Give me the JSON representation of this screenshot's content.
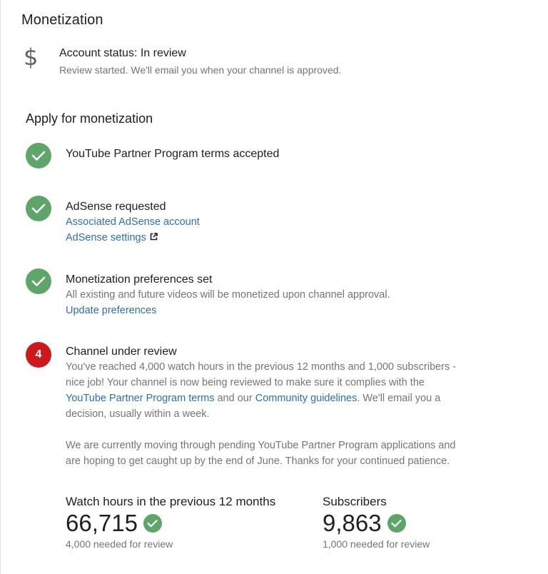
{
  "page": {
    "title": "Monetization"
  },
  "account_status": {
    "icon": "dollar-icon",
    "icon_glyph": "$",
    "title": "Account status: In review",
    "subtitle": "Review started. We'll email you when your channel is approved."
  },
  "apply": {
    "title": "Apply for monetization",
    "steps": [
      {
        "state": "done",
        "title": "YouTube Partner Program terms accepted"
      },
      {
        "state": "done",
        "title": "AdSense requested",
        "links": [
          "Associated AdSense account",
          "AdSense settings"
        ]
      },
      {
        "state": "done",
        "title": "Monetization preferences set",
        "description": "All existing and future videos will be monetized upon channel approval.",
        "link": "Update preferences"
      },
      {
        "state": "pending",
        "number": "4",
        "title": "Channel under review",
        "para1_before": "You've reached 4,000 watch hours in the previous 12 months and 1,000 subscribers - nice job! Your channel is now being reviewed to make sure it complies with the ",
        "para1_link1": "YouTube Partner Program terms",
        "para1_mid": " and our ",
        "para1_link2": "Community guidelines",
        "para1_after": ". We'll email you a decision, usually within a week.",
        "para2": "We are currently moving through pending YouTube Partner Program applications and are hoping to get caught up by the end of June. Thanks for your continued patience."
      }
    ]
  },
  "stats": {
    "watch_hours": {
      "label": "Watch hours in the previous 12 months",
      "value": "66,715",
      "requirement": "4,000 needed for review"
    },
    "subscribers": {
      "label": "Subscribers",
      "value": "9,863",
      "requirement": "1,000 needed for review"
    }
  },
  "colors": {
    "success": "#5fa56a",
    "pending": "#cc1a1a",
    "link": "#2d6fb0",
    "secondary_text": "#757575"
  }
}
